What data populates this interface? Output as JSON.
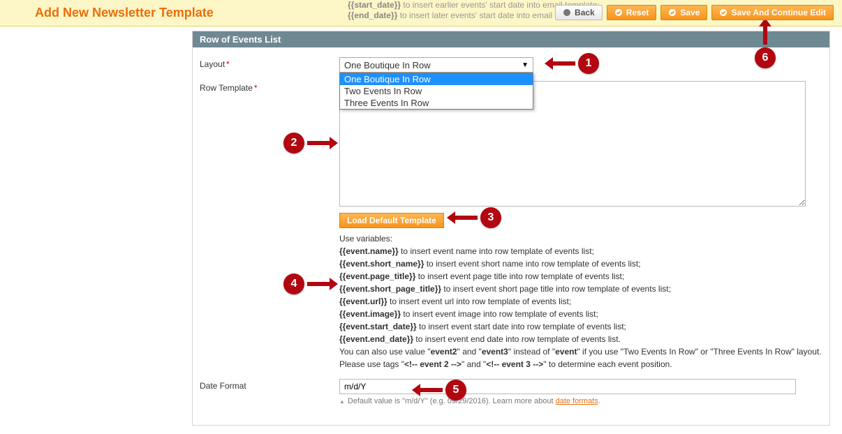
{
  "header": {
    "title": "Add New Newsletter Template",
    "hint_top": {
      "line1_var": "{{start_date}}",
      "line1_text": " to insert earlier events' start date into email template;",
      "line2_var": "{{end_date}}",
      "line2_text": " to insert later events' start date into email template."
    }
  },
  "toolbar": {
    "back": "Back",
    "reset": "Reset",
    "save": "Save",
    "save_continue": "Save And Continue Edit"
  },
  "panel": {
    "title": "Row of Events List",
    "layout_label": "Layout",
    "row_template_label": "Row Template",
    "date_format_label": "Date Format",
    "required_marker": "*"
  },
  "layout_select": {
    "selected": "One Boutique In Row",
    "options": [
      "One Boutique In Row",
      "Two Events In Row",
      "Three Events In Row"
    ]
  },
  "load_default_button": "Load Default Template",
  "help": {
    "use_vars": "Use variables:",
    "lines": [
      {
        "var": "{{event.name}}",
        "text": " to insert event name into row template of events list;"
      },
      {
        "var": "{{event.short_name}}",
        "text": " to insert event short name into row template of events list;"
      },
      {
        "var": "{{event.page_title}}",
        "text": " to insert event page title into row template of events list;"
      },
      {
        "var": "{{event.short_page_title}}",
        "text": " to insert event short page title into row template of events list;"
      },
      {
        "var": "{{event.url}}",
        "text": " to insert event url into row template of events list;"
      },
      {
        "var": "{{event.image}}",
        "text": " to insert event image into row template of events list;"
      },
      {
        "var": "{{event.start_date}}",
        "text": " to insert event start date into row template of events list;"
      },
      {
        "var": "{{event.end_date}}",
        "text": " to insert event end date into row template of events list."
      }
    ],
    "also_pre": "You can also use value \"",
    "also_e2": "event2",
    "also_mid1": "\" and \"",
    "also_e3": "event3",
    "also_mid2": "\" instead of \"",
    "also_ev": "event",
    "also_post": "\" if you use \"Two Events In Row\" or \"Three Events In Row\" layout.",
    "tags_pre": "Please use tags \"",
    "tags_t2": "<!-- event 2 -->",
    "tags_mid": "\" and \"",
    "tags_t3": "<!-- event 3 -->",
    "tags_post": "\" to determine each event position."
  },
  "date_format": {
    "value": "m/d/Y",
    "note_prefix": "Default value is \"m/d/Y\" (e.g. 09/29/2016). Learn more about ",
    "link_text": "date formats",
    "note_suffix": "."
  },
  "callouts": {
    "c1": "1",
    "c2": "2",
    "c3": "3",
    "c4": "4",
    "c5": "5",
    "c6": "6"
  }
}
